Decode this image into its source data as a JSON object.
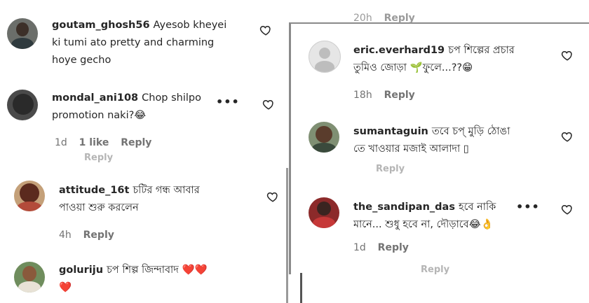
{
  "left": {
    "comments": [
      {
        "username": "goutam_ghosh56",
        "lines": [
          "Ayesob kheyei",
          "ki tumi ato pretty and charming",
          "hoye gecho"
        ]
      },
      {
        "username": "mondal_ani108",
        "lines": [
          "Chop shilpo",
          "promotion naki?😂"
        ],
        "time": "1d",
        "likes": "1 like",
        "reply": "Reply"
      },
      {
        "username": "attitude_16t",
        "lines": [
          "চটির গন্ধ আবার",
          "পাওয়া শুরু করলেন"
        ],
        "time": "4h",
        "reply": "Reply"
      },
      {
        "username": "goluriju",
        "lines": [
          "চপ শিল্প জিন্দাবাদ ❤️❤️",
          "❤️"
        ]
      }
    ],
    "more_icon": "•••",
    "ghost_reply": "Reply"
  },
  "right": {
    "top_meta": {
      "time": "20h",
      "reply": "Reply"
    },
    "comments": [
      {
        "username": "eric.everhard19",
        "lines": [
          "চপ শিল্পের প্রচার",
          "তুমিও জোড়া 🌱ফুলে...??😁"
        ],
        "time": "18h",
        "reply": "Reply"
      },
      {
        "username": "sumantaguin",
        "lines": [
          "তবে চপ্ মুড়ি ঠোঙা",
          "তে খাওয়ার মজাই আলাদা ▯"
        ]
      },
      {
        "username": "the_sandipan_das",
        "lines": [
          "হবে নাকি",
          "মানে... শুধু হবে না, দৌড়াবে😂👌"
        ],
        "time": "1d",
        "reply": "Reply"
      }
    ],
    "more_icon": "•••",
    "ghost_reply": "Reply"
  },
  "icons": {
    "like": "heart-outline-icon",
    "more": "more-options-icon"
  },
  "colors": {
    "heart_filled": "#e0245e",
    "meta_grey": "#737373"
  }
}
